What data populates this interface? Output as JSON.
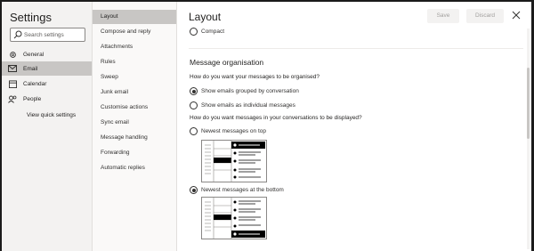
{
  "nav": {
    "title": "Settings",
    "search_placeholder": "Search settings",
    "items": [
      {
        "label": "General",
        "icon": "gear-icon"
      },
      {
        "label": "Email",
        "icon": "mail-icon"
      },
      {
        "label": "Calendar",
        "icon": "calendar-icon"
      },
      {
        "label": "People",
        "icon": "people-icon"
      }
    ],
    "quick_settings": "View quick settings"
  },
  "subnav": {
    "items": [
      "Layout",
      "Compose and reply",
      "Attachments",
      "Rules",
      "Sweep",
      "Junk email",
      "Customise actions",
      "Sync email",
      "Message handling",
      "Forwarding",
      "Automatic replies"
    ]
  },
  "main": {
    "title": "Layout",
    "save_label": "Save",
    "discard_label": "Discard",
    "compact_label": "Compact",
    "section_title": "Message organisation",
    "question1": "How do you want your messages to be organised?",
    "option_grouped": "Show emails grouped by conversation",
    "option_individual": "Show emails as individual messages",
    "question2": "How do you want messages in your conversations to be displayed?",
    "option_newest_top": "Newest messages on top",
    "option_newest_bottom": "Newest messages at the bottom"
  },
  "colors": {
    "selected_bg": "#c8c6c4",
    "nav_bg": "#f3f2f1",
    "border": "#8a8886"
  }
}
